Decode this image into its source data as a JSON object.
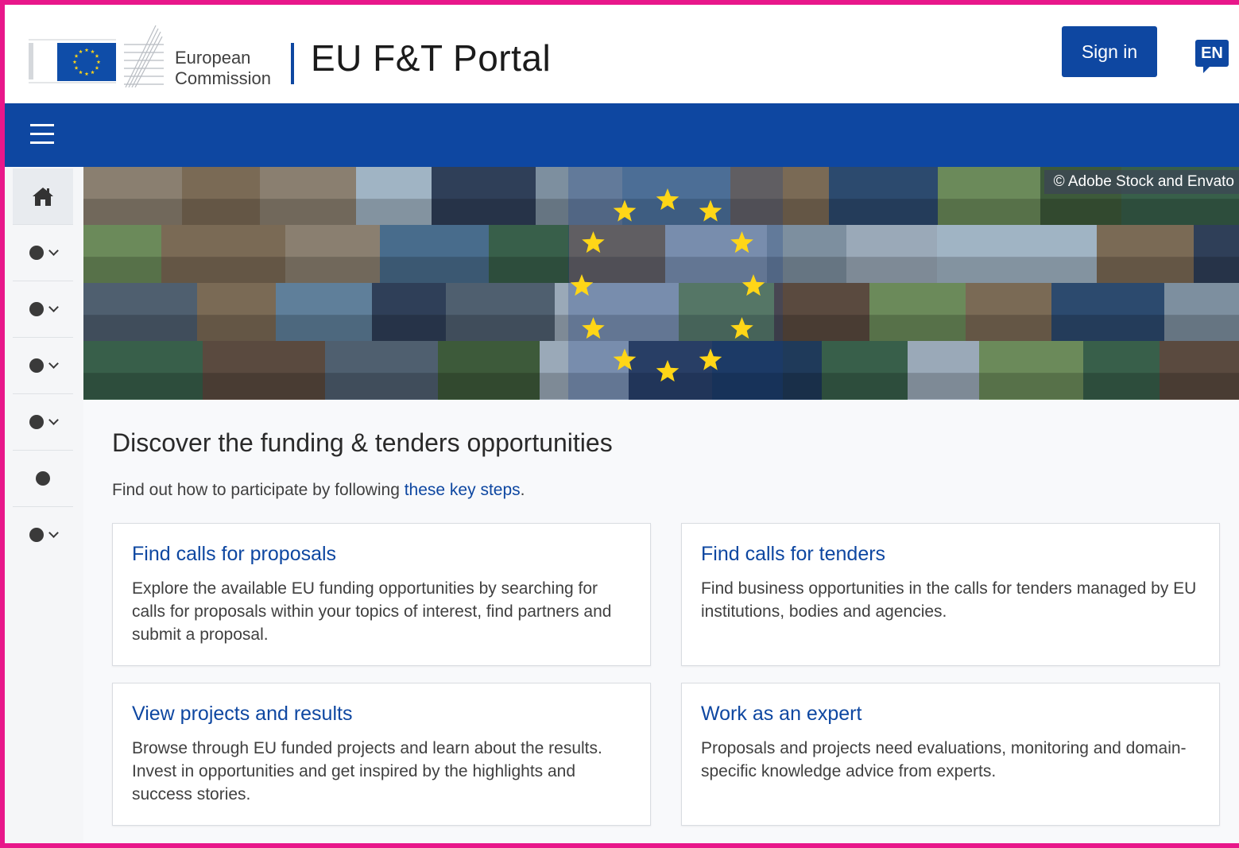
{
  "header": {
    "org_line1": "European",
    "org_line2": "Commission",
    "portal_title": "EU F&T Portal",
    "signin_label": "Sign in",
    "language": "EN"
  },
  "banner": {
    "copyright": "© Adobe Stock and Envato"
  },
  "main": {
    "heading": "Discover the funding & tenders opportunities",
    "intro_text": "Find out how to participate by following ",
    "intro_link": "these key steps",
    "intro_end": ".",
    "cards": [
      {
        "title": "Find calls for proposals",
        "text": "Explore the available EU funding opportunities by searching for calls for proposals within your topics of interest, find partners and submit a proposal."
      },
      {
        "title": "Find calls for tenders",
        "text": "Find business opportunities in the calls for tenders managed by EU institutions, bodies and agencies."
      },
      {
        "title": "View projects and results",
        "text": "Browse through EU funded projects and learn about the results. Invest in opportunities and get inspired by the highlights and success stories."
      },
      {
        "title": "Work as an expert",
        "text": "Proposals and projects need evaluations, monitoring and domain-specific knowledge advice from experts."
      }
    ]
  },
  "icons": {
    "menu": "hamburger-icon",
    "home": "home-icon",
    "bullet": "dot-icon",
    "expand": "chevron-down-icon"
  },
  "colors": {
    "brand_blue": "#0e47a1",
    "eu_flag_blue": "#0f4da8",
    "eu_star_yellow": "#ffd617",
    "frame_pink": "#e8178a"
  }
}
